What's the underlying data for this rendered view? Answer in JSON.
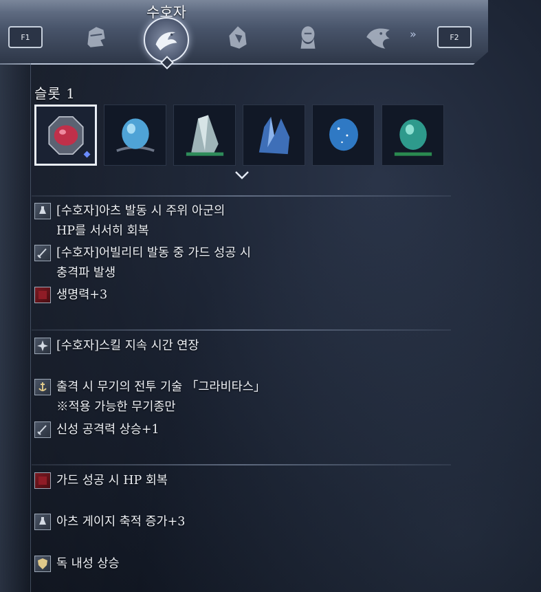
{
  "header": {
    "selected_class": "수호자",
    "key_prev": "F1",
    "key_next": "F2",
    "more_glyph": "»",
    "class_icons": [
      "knight-helmet-icon",
      "eagle-emblem-icon",
      "hooded-figure-icon",
      "veiled-woman-icon",
      "dragon-crest-icon"
    ]
  },
  "slot": {
    "title": "슬롯 1",
    "gems": [
      {
        "name": "red-ornate-gem",
        "color": "#c0304a",
        "selected": true
      },
      {
        "name": "blue-orb-gem",
        "color": "#4fa3d6",
        "selected": false
      },
      {
        "name": "crystal-shard-gem",
        "color": "#9fb4b8",
        "selected": false
      },
      {
        "name": "blue-crystal-cluster-gem",
        "color": "#3e6fb8",
        "selected": false
      },
      {
        "name": "starry-blue-orb-gem",
        "color": "#2f79c4",
        "selected": false
      },
      {
        "name": "teal-orb-gem",
        "color": "#2e9a8c",
        "selected": false
      }
    ]
  },
  "effects": [
    {
      "icon": "potion-icon",
      "lines": [
        "[수호자]아츠 발동 시 주위 아군의",
        "HP를 서서히 회복"
      ]
    },
    {
      "icon": "sword-icon",
      "lines": [
        "[수호자]어빌리티 발동 중 가드 성공 시",
        "충격파 발생"
      ]
    },
    {
      "icon": "health-block-icon",
      "lines": [
        "생명력+3"
      ]
    },
    {
      "icon": "sparkle-icon",
      "lines": [
        "[수호자]스킬 지속 시간 연장"
      ]
    },
    {
      "icon": "anchor-icon",
      "lines": [
        "출격 시 무기의 전투 기술 「그라비타스」",
        "※적용 가능한 무기종만"
      ]
    },
    {
      "icon": "sword-icon",
      "lines": [
        "신성 공격력 상승+1"
      ]
    },
    {
      "icon": "health-block-icon",
      "lines": [
        "가드 성공 시 HP 회복"
      ]
    },
    {
      "icon": "potion-icon",
      "lines": [
        "아츠 게이지 축적 증가+3"
      ]
    },
    {
      "icon": "shield-badge-icon",
      "lines": [
        "독 내성 상승"
      ]
    }
  ]
}
